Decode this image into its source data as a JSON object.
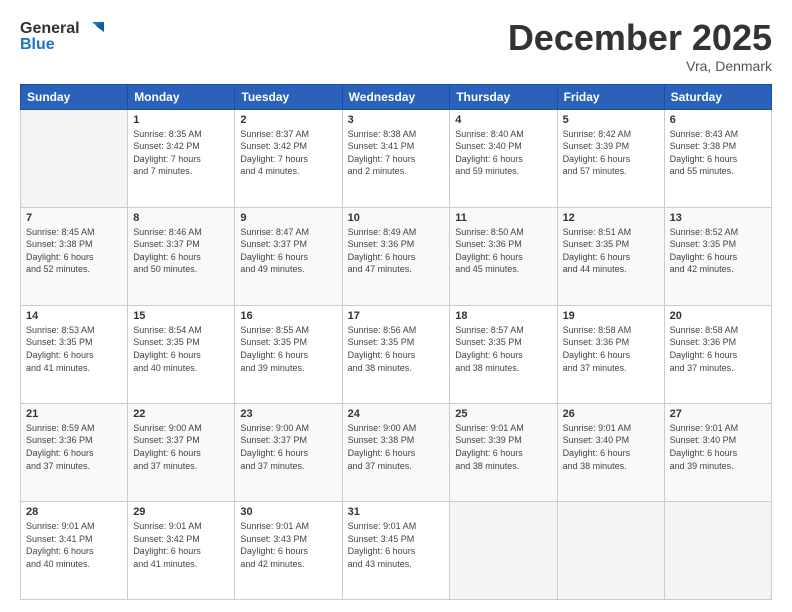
{
  "logo": {
    "line1": "General",
    "line2": "Blue"
  },
  "title": "December 2025",
  "subtitle": "Vra, Denmark",
  "days_header": [
    "Sunday",
    "Monday",
    "Tuesday",
    "Wednesday",
    "Thursday",
    "Friday",
    "Saturday"
  ],
  "weeks": [
    [
      {
        "day": "",
        "info": ""
      },
      {
        "day": "1",
        "info": "Sunrise: 8:35 AM\nSunset: 3:42 PM\nDaylight: 7 hours\nand 7 minutes."
      },
      {
        "day": "2",
        "info": "Sunrise: 8:37 AM\nSunset: 3:42 PM\nDaylight: 7 hours\nand 4 minutes."
      },
      {
        "day": "3",
        "info": "Sunrise: 8:38 AM\nSunset: 3:41 PM\nDaylight: 7 hours\nand 2 minutes."
      },
      {
        "day": "4",
        "info": "Sunrise: 8:40 AM\nSunset: 3:40 PM\nDaylight: 6 hours\nand 59 minutes."
      },
      {
        "day": "5",
        "info": "Sunrise: 8:42 AM\nSunset: 3:39 PM\nDaylight: 6 hours\nand 57 minutes."
      },
      {
        "day": "6",
        "info": "Sunrise: 8:43 AM\nSunset: 3:38 PM\nDaylight: 6 hours\nand 55 minutes."
      }
    ],
    [
      {
        "day": "7",
        "info": "Sunrise: 8:45 AM\nSunset: 3:38 PM\nDaylight: 6 hours\nand 52 minutes."
      },
      {
        "day": "8",
        "info": "Sunrise: 8:46 AM\nSunset: 3:37 PM\nDaylight: 6 hours\nand 50 minutes."
      },
      {
        "day": "9",
        "info": "Sunrise: 8:47 AM\nSunset: 3:37 PM\nDaylight: 6 hours\nand 49 minutes."
      },
      {
        "day": "10",
        "info": "Sunrise: 8:49 AM\nSunset: 3:36 PM\nDaylight: 6 hours\nand 47 minutes."
      },
      {
        "day": "11",
        "info": "Sunrise: 8:50 AM\nSunset: 3:36 PM\nDaylight: 6 hours\nand 45 minutes."
      },
      {
        "day": "12",
        "info": "Sunrise: 8:51 AM\nSunset: 3:35 PM\nDaylight: 6 hours\nand 44 minutes."
      },
      {
        "day": "13",
        "info": "Sunrise: 8:52 AM\nSunset: 3:35 PM\nDaylight: 6 hours\nand 42 minutes."
      }
    ],
    [
      {
        "day": "14",
        "info": "Sunrise: 8:53 AM\nSunset: 3:35 PM\nDaylight: 6 hours\nand 41 minutes."
      },
      {
        "day": "15",
        "info": "Sunrise: 8:54 AM\nSunset: 3:35 PM\nDaylight: 6 hours\nand 40 minutes."
      },
      {
        "day": "16",
        "info": "Sunrise: 8:55 AM\nSunset: 3:35 PM\nDaylight: 6 hours\nand 39 minutes."
      },
      {
        "day": "17",
        "info": "Sunrise: 8:56 AM\nSunset: 3:35 PM\nDaylight: 6 hours\nand 38 minutes."
      },
      {
        "day": "18",
        "info": "Sunrise: 8:57 AM\nSunset: 3:35 PM\nDaylight: 6 hours\nand 38 minutes."
      },
      {
        "day": "19",
        "info": "Sunrise: 8:58 AM\nSunset: 3:36 PM\nDaylight: 6 hours\nand 37 minutes."
      },
      {
        "day": "20",
        "info": "Sunrise: 8:58 AM\nSunset: 3:36 PM\nDaylight: 6 hours\nand 37 minutes."
      }
    ],
    [
      {
        "day": "21",
        "info": "Sunrise: 8:59 AM\nSunset: 3:36 PM\nDaylight: 6 hours\nand 37 minutes."
      },
      {
        "day": "22",
        "info": "Sunrise: 9:00 AM\nSunset: 3:37 PM\nDaylight: 6 hours\nand 37 minutes."
      },
      {
        "day": "23",
        "info": "Sunrise: 9:00 AM\nSunset: 3:37 PM\nDaylight: 6 hours\nand 37 minutes."
      },
      {
        "day": "24",
        "info": "Sunrise: 9:00 AM\nSunset: 3:38 PM\nDaylight: 6 hours\nand 37 minutes."
      },
      {
        "day": "25",
        "info": "Sunrise: 9:01 AM\nSunset: 3:39 PM\nDaylight: 6 hours\nand 38 minutes."
      },
      {
        "day": "26",
        "info": "Sunrise: 9:01 AM\nSunset: 3:40 PM\nDaylight: 6 hours\nand 38 minutes."
      },
      {
        "day": "27",
        "info": "Sunrise: 9:01 AM\nSunset: 3:40 PM\nDaylight: 6 hours\nand 39 minutes."
      }
    ],
    [
      {
        "day": "28",
        "info": "Sunrise: 9:01 AM\nSunset: 3:41 PM\nDaylight: 6 hours\nand 40 minutes."
      },
      {
        "day": "29",
        "info": "Sunrise: 9:01 AM\nSunset: 3:42 PM\nDaylight: 6 hours\nand 41 minutes."
      },
      {
        "day": "30",
        "info": "Sunrise: 9:01 AM\nSunset: 3:43 PM\nDaylight: 6 hours\nand 42 minutes."
      },
      {
        "day": "31",
        "info": "Sunrise: 9:01 AM\nSunset: 3:45 PM\nDaylight: 6 hours\nand 43 minutes."
      },
      {
        "day": "",
        "info": ""
      },
      {
        "day": "",
        "info": ""
      },
      {
        "day": "",
        "info": ""
      }
    ]
  ]
}
